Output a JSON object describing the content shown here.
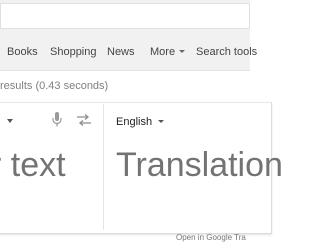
{
  "nav": {
    "items": [
      {
        "label": "Books"
      },
      {
        "label": "Shopping"
      },
      {
        "label": "News"
      },
      {
        "label": "More"
      },
      {
        "label": "Search tools"
      }
    ]
  },
  "results_stats": "results (0.43 seconds)",
  "translate": {
    "target_language": "English",
    "source_placeholder": "r text",
    "translation_placeholder": "Translation",
    "open_link": "Open in Google Tra"
  },
  "icons": {
    "source_dropdown": "chevron-down-icon",
    "microphone": "microphone-icon",
    "swap": "swap-languages-icon",
    "target_dropdown": "chevron-down-icon"
  }
}
